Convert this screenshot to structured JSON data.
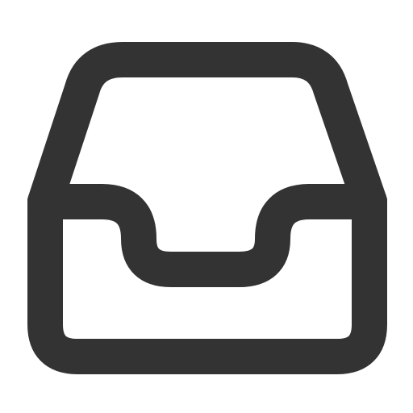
{
  "icon": {
    "name": "inbox-icon",
    "stroke_color": "#333333",
    "background_color": "#ffffff"
  }
}
